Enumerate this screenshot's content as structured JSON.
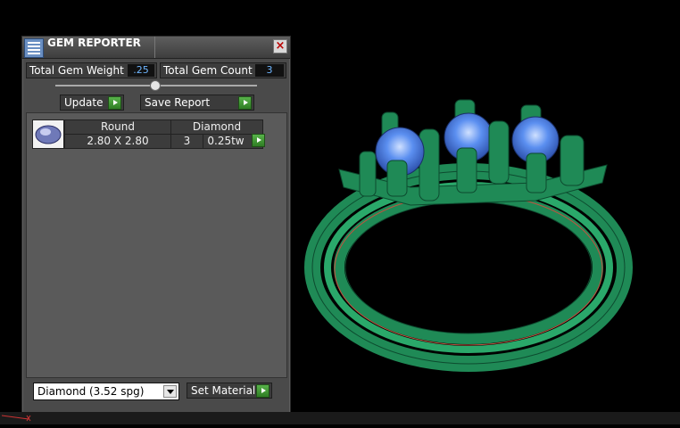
{
  "panel": {
    "title": "GEM REPORTER",
    "close_glyph": "×",
    "total_gem_weight_label": "Total Gem Weight",
    "total_gem_weight_value": ".25",
    "total_gem_count_label": "Total Gem Count",
    "total_gem_count_value": "3",
    "update_label": "Update",
    "save_report_label": "Save Report",
    "gem_table": {
      "shape": "Round",
      "type": "Diamond",
      "size": "2.80 X 2.80",
      "count": "3",
      "weight": "0.25tw"
    },
    "material_select_value": "Diamond     (3.52 spg)",
    "set_material_label": "Set Material"
  },
  "colors": {
    "ring": "#1f8a56",
    "stone": "#4a7fe5",
    "accent_green": "#2f7d24",
    "value_blue": "#6fb6ff"
  },
  "icons": {
    "gem_reporter": "gem-reporter-icon",
    "thumbnail": "gem-thumbnail-icon"
  }
}
